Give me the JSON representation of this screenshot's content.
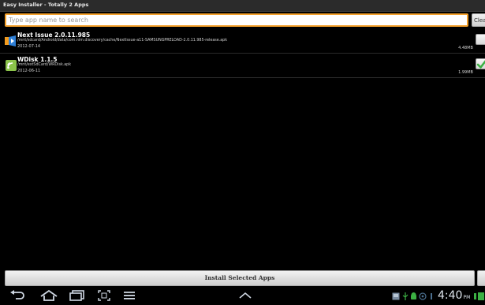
{
  "window": {
    "title": "Easy Installer - Totally 2 Apps"
  },
  "search": {
    "placeholder": "Type app name to search",
    "clear_label": "Clear"
  },
  "apps": [
    {
      "name": "Next Issue 2.0.11.985",
      "path": "/mnt/sdcard/Android/data/com.nim.discovery/cache/NextIssue-a11-SAMSUNGPRELOAD-2.0.11.985-release.apk",
      "date": "2012-07-14",
      "size": "4.48MB",
      "checked": false,
      "icon": "next-issue-app-icon"
    },
    {
      "name": "WDisk 1.1.5",
      "path": "/mnt/extSdCard/WRDisk.apk",
      "date": "2012-06-11",
      "size": "1.99MB",
      "checked": true,
      "icon": "wifi-disk-app-icon"
    }
  ],
  "actions": {
    "install_label": "Install Selected Apps"
  },
  "system_bar": {
    "time": "4:40",
    "ampm": "PM",
    "icons": [
      "back-icon",
      "home-icon",
      "recent-apps-icon",
      "screenshot-icon",
      "menu-icon",
      "chevron-up-icon",
      "gallery-icon",
      "usb-icon",
      "android-notification-icon",
      "sync-icon",
      "wifi-icon",
      "battery-icon"
    ]
  },
  "colors": {
    "accent": "#f3a02b",
    "check": "#3cb043",
    "background": "#000000"
  }
}
